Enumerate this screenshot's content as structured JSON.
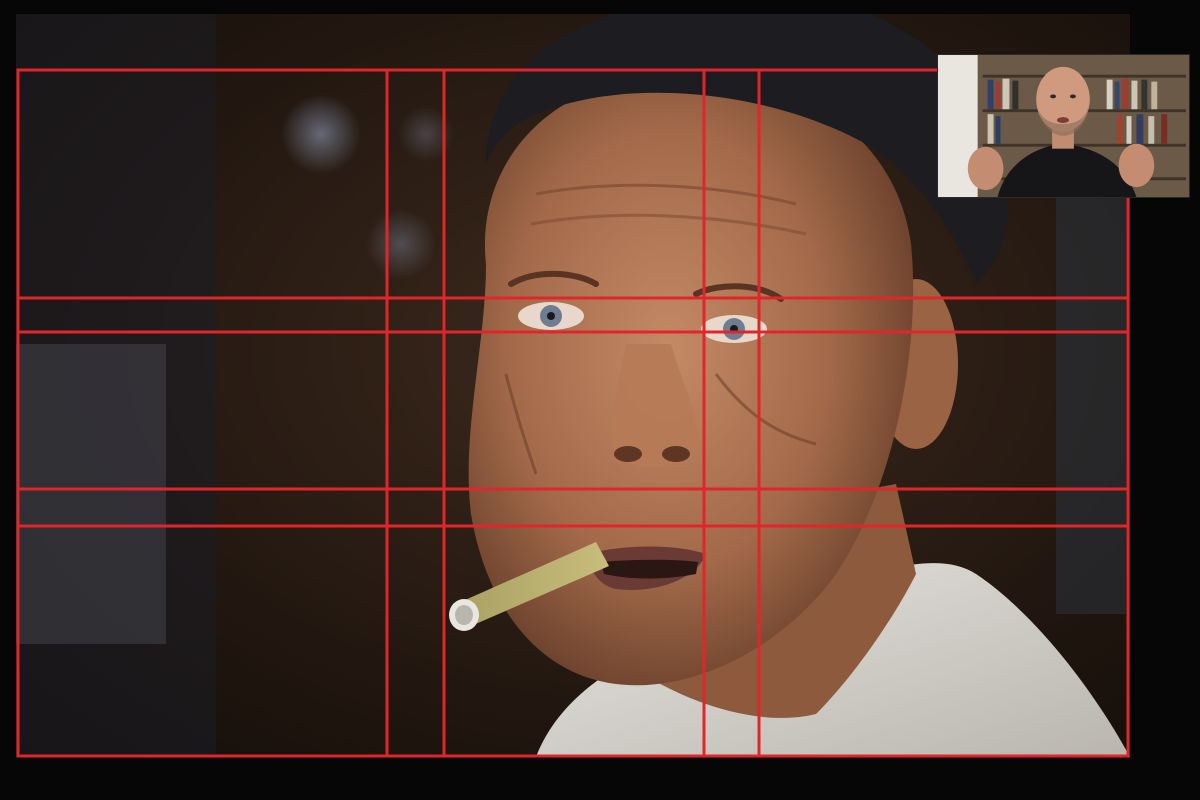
{
  "screen": {
    "background_color": "#060606"
  },
  "photo": {
    "subject": "portrait-photo",
    "description_icon": "portrait-photo-icon"
  },
  "composition_grid": {
    "color": "#e0262b",
    "vertical_line_count": 6,
    "horizontal_line_count": 6
  },
  "webcam": {
    "overlay": "presenter-webcam",
    "icon": "webcam-presenter-icon"
  }
}
